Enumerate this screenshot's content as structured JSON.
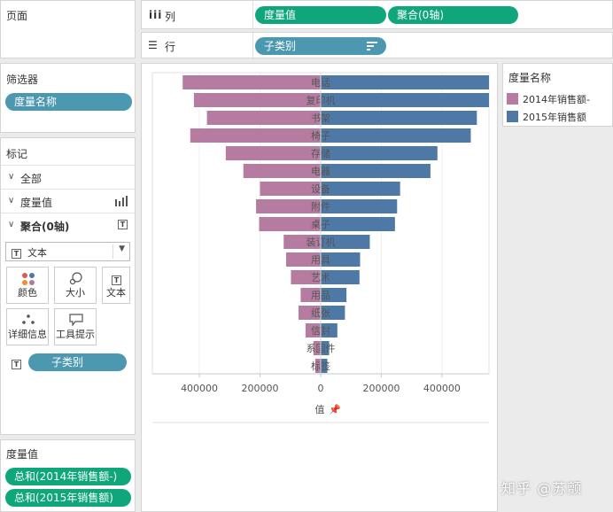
{
  "pages_panel": {
    "title": "页面"
  },
  "columns_shelf": {
    "icon": "iii",
    "label": "列",
    "pills": [
      "度量值",
      "聚合(0轴)"
    ]
  },
  "rows_shelf": {
    "icon": "☰",
    "label": "行",
    "pills": [
      "子类别"
    ]
  },
  "filters_panel": {
    "title": "筛选器",
    "pills": [
      "度量名称"
    ]
  },
  "marks_panel": {
    "title": "标记",
    "rows": [
      {
        "label": "全部"
      },
      {
        "label": "度量值"
      },
      {
        "label": "聚合(0轴)"
      }
    ],
    "type_select": "文本",
    "cards": [
      "颜色",
      "大小",
      "文本",
      "详细信息",
      "工具提示"
    ],
    "field_pill": "子类别"
  },
  "measure_values_panel": {
    "title": "度量值",
    "pills": [
      "总和(2014年销售额-)",
      "总和(2015年销售额)"
    ]
  },
  "legend_panel": {
    "title": "度量名称",
    "items": [
      {
        "label": "2014年销售额-",
        "color": "#b57ba0"
      },
      {
        "label": "2015年销售额",
        "color": "#4e79a7"
      }
    ]
  },
  "axis": {
    "title": "值",
    "pin_icon": "📌"
  },
  "watermark": "知乎 @苏颤",
  "chart_data": {
    "type": "bar",
    "categories": [
      "电话",
      "复印机",
      "书架",
      "椅子",
      "存储",
      "电器",
      "设备",
      "附件",
      "桌子",
      "装订机",
      "用具",
      "艺术",
      "用品",
      "纸张",
      "信封",
      "系固件",
      "标签"
    ],
    "series": [
      {
        "name": "2014年销售额-",
        "color": "#b57ba0",
        "values": [
          -455000,
          -418000,
          -375000,
          -430000,
          -313000,
          -255000,
          -200000,
          -213000,
          -203000,
          -122000,
          -114000,
          -98000,
          -66000,
          -73000,
          -50000,
          -24000,
          -18000
        ]
      },
      {
        "name": "2015年销售额",
        "color": "#4e79a7",
        "values": [
          555000,
          555000,
          515000,
          495000,
          385000,
          362000,
          262000,
          252000,
          245000,
          162000,
          130000,
          128000,
          85000,
          80000,
          55000,
          28000,
          22000
        ]
      }
    ],
    "x_ticks": [
      -400000,
      -200000,
      0,
      200000,
      400000
    ],
    "x_tick_labels": [
      "400000",
      "200000",
      "0",
      "200000",
      "400000"
    ],
    "xlim": [
      -555000,
      555000
    ],
    "xlabel": "值",
    "grid": true,
    "legend": "right"
  }
}
